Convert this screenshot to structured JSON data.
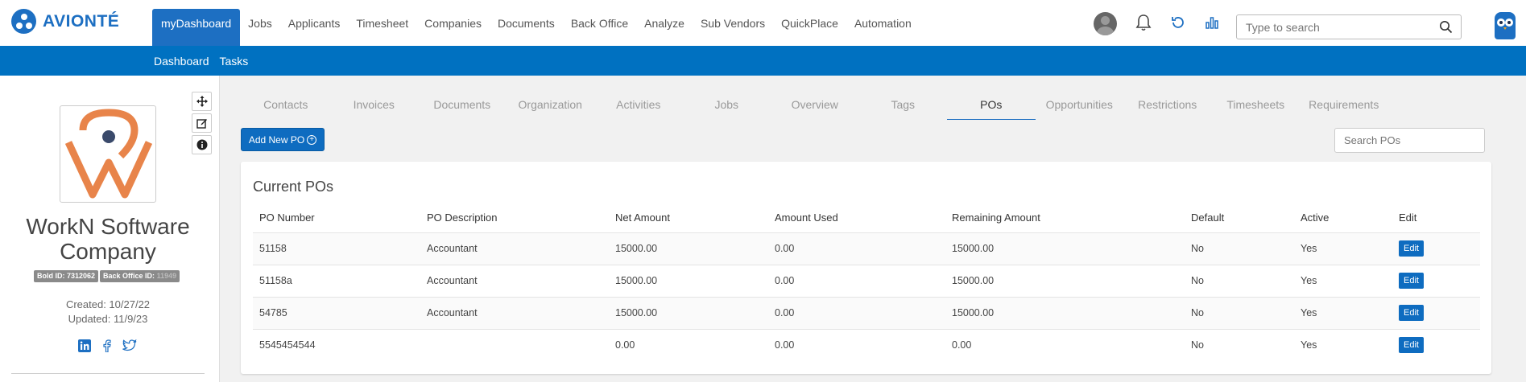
{
  "brand": {
    "name": "AVIONTÉ"
  },
  "nav": {
    "items": [
      "myDashboard",
      "Jobs",
      "Applicants",
      "Timesheet",
      "Companies",
      "Documents",
      "Back Office",
      "Analyze",
      "Sub Vendors",
      "QuickPlace",
      "Automation"
    ],
    "active": "myDashboard"
  },
  "header": {
    "search_placeholder": "Type to search"
  },
  "subnav": {
    "items": [
      "Dashboard",
      "Tasks"
    ]
  },
  "company": {
    "name_line1": "WorkN Software",
    "name_line2": "Company",
    "bold_id_label": "Bold ID: 7312062",
    "back_office_label": "Back Office ID:",
    "back_office_value": "11949",
    "created": "Created: 10/27/22",
    "updated": "Updated: 11/9/23"
  },
  "tabs": {
    "items": [
      "Contacts",
      "Invoices",
      "Documents",
      "Organization",
      "Activities",
      "Jobs",
      "Overview",
      "Tags",
      "POs",
      "Opportunities",
      "Restrictions",
      "Timesheets",
      "Requirements"
    ],
    "active": "POs"
  },
  "toolbar": {
    "add_label": "Add New PO",
    "search_placeholder": "Search POs"
  },
  "pos": {
    "title": "Current POs",
    "columns": [
      "PO Number",
      "PO Description",
      "Net Amount",
      "Amount Used",
      "Remaining Amount",
      "Default",
      "Active",
      "Edit"
    ],
    "rows": [
      {
        "number": "51158",
        "description": "Accountant",
        "net": "15000.00",
        "used": "0.00",
        "remaining": "15000.00",
        "default": "No",
        "active": "Yes",
        "edit": "Edit"
      },
      {
        "number": "51158a",
        "description": "Accountant",
        "net": "15000.00",
        "used": "0.00",
        "remaining": "15000.00",
        "default": "No",
        "active": "Yes",
        "edit": "Edit"
      },
      {
        "number": "54785",
        "description": "Accountant",
        "net": "15000.00",
        "used": "0.00",
        "remaining": "15000.00",
        "default": "No",
        "active": "Yes",
        "edit": "Edit"
      },
      {
        "number": "5545454544",
        "description": "",
        "net": "0.00",
        "used": "0.00",
        "remaining": "0.00",
        "default": "No",
        "active": "Yes",
        "edit": "Edit"
      }
    ]
  },
  "colors": {
    "brand_blue": "#1d6fc2",
    "subbar_blue": "#0071c1",
    "logo_orange": "#e8844a",
    "logo_navy": "#3a4a6b"
  }
}
